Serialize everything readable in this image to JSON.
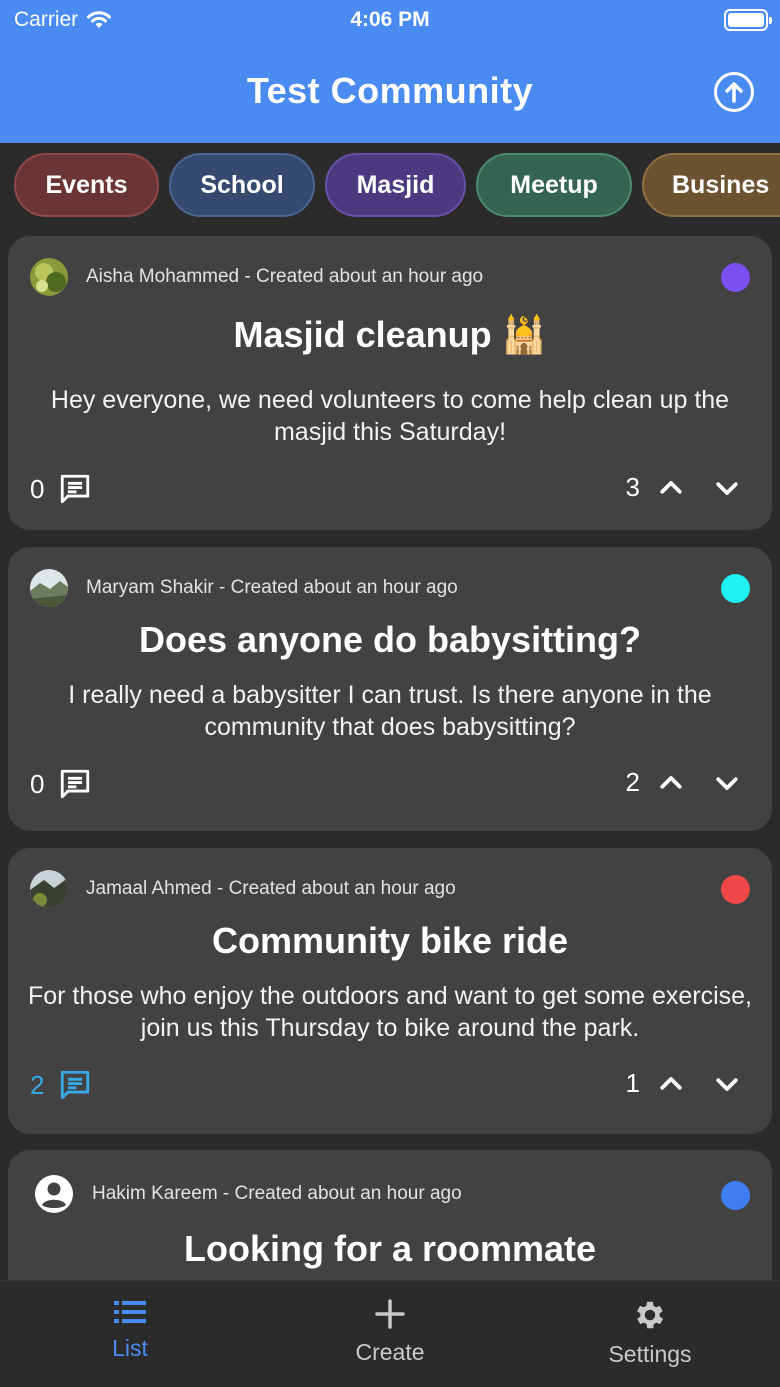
{
  "status_bar": {
    "carrier": "Carrier",
    "time": "4:06 PM"
  },
  "header": {
    "title": "Test Community"
  },
  "categories": [
    {
      "label": "Events",
      "bg": "#6b3535",
      "border": "#8e4848"
    },
    {
      "label": "School",
      "bg": "#344a6e",
      "border": "#4a6590"
    },
    {
      "label": "Masjid",
      "bg": "#4a3a80",
      "border": "#6650a8"
    },
    {
      "label": "Meetup",
      "bg": "#356552",
      "border": "#4a8a6e"
    },
    {
      "label": "Busines",
      "bg": "#6b5230",
      "border": "#8f6e42"
    }
  ],
  "posts": [
    {
      "author_line": "Aisha Mohammed - Created about an hour ago",
      "title": "Masjid cleanup 🕌",
      "body": "Hey everyone, we need volunteers to come help clean up the masjid this Saturday!",
      "comment_count": "0",
      "vote_count": "3",
      "dot_color": "#7b4ff0",
      "highlight_comments": false
    },
    {
      "author_line": "Maryam Shakir - Created about an hour ago",
      "title": "Does anyone do babysitting?",
      "body": "I really need a babysitter I can trust. Is there anyone in the community that does babysitting?",
      "comment_count": "0",
      "vote_count": "2",
      "dot_color": "#1ff0f0",
      "highlight_comments": false
    },
    {
      "author_line": "Jamaal Ahmed - Created about an hour ago",
      "title": "Community bike ride",
      "body": "For those who enjoy the outdoors and want to get some exercise, join us this Thursday to bike around the park.",
      "comment_count": "2",
      "vote_count": "1",
      "dot_color": "#f04848",
      "highlight_comments": true
    },
    {
      "author_line": "Hakim Kareem - Created about an hour ago",
      "title": "Looking for a roommate",
      "dot_color": "#3f7ef0"
    }
  ],
  "tabbar": {
    "items": [
      {
        "label": "List",
        "icon": "list-icon",
        "active": true
      },
      {
        "label": "Create",
        "icon": "plus-icon",
        "active": false
      },
      {
        "label": "Settings",
        "icon": "gear-icon",
        "active": false
      }
    ]
  },
  "colors": {
    "accent": "#4a8bf2",
    "link_blue": "#39a8e8",
    "card": "#424242",
    "background": "#2b2b2b"
  }
}
